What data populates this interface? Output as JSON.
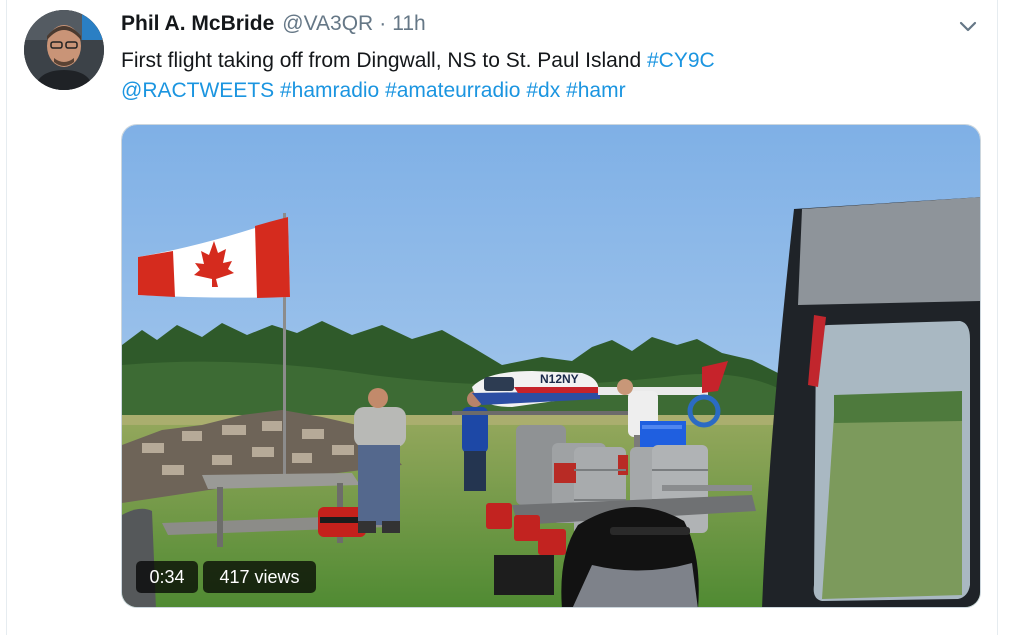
{
  "tweet": {
    "display_name": "Phil A. McBride",
    "handle": "@VA3QR",
    "separator": "·",
    "age": "11h",
    "text_plain": "First flight taking off from Dingwall, NS to St. Paul Island ",
    "hashtag_cy9c": "#CY9C",
    "mention_ractweets": "@RACTWEETS",
    "hashtag_hamradio": "#hamradio",
    "hashtag_amateurradio": "#amateurradio",
    "hashtag_dx": "#dx",
    "hashtag_hamr": "#hamr"
  },
  "media": {
    "helicopter_registration": "N12NY",
    "duration": "0:34",
    "views": "417 views"
  },
  "colors": {
    "link": "#1b95e0",
    "text": "#14171a",
    "secondary": "#657786"
  },
  "icons": {
    "menu": "chevron-down-icon",
    "flag": "canada-flag"
  }
}
